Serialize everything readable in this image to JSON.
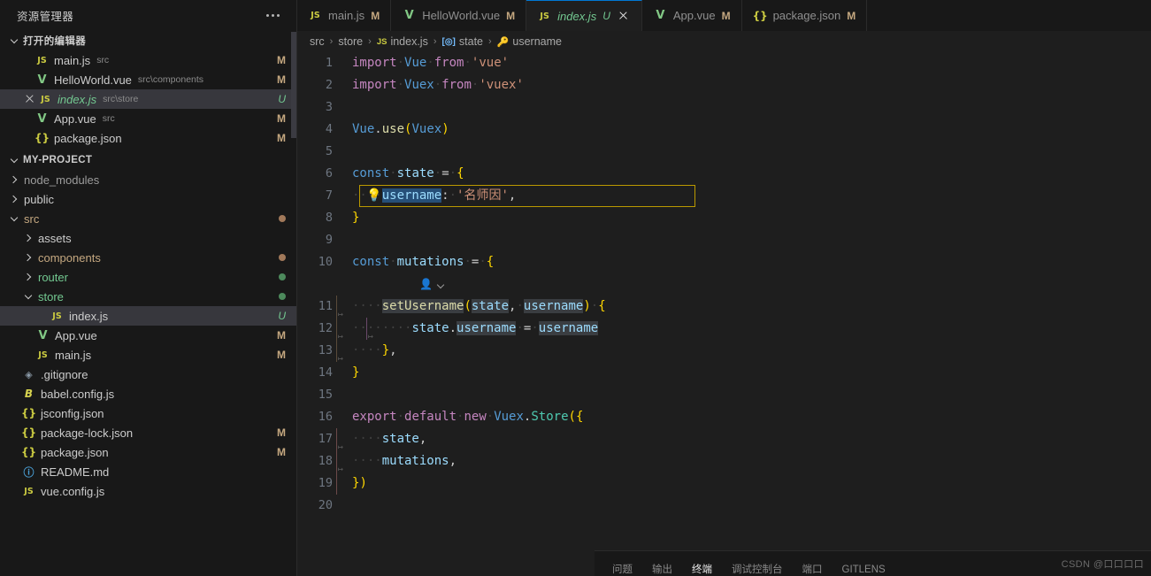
{
  "sidebar": {
    "title": "资源管理器",
    "more_label": "···",
    "open_editors": {
      "label": "打开的编辑器",
      "items": [
        {
          "icon": "js-file-icon",
          "glyph": "JS",
          "name": "main.js",
          "path": "src",
          "badge": "M",
          "selected": false,
          "unsaved": false
        },
        {
          "icon": "vue-file-icon",
          "glyph": "V",
          "name": "HelloWorld.vue",
          "path": "src\\components",
          "badge": "M",
          "selected": false,
          "unsaved": false
        },
        {
          "icon": "js-file-icon",
          "glyph": "JS",
          "name": "index.js",
          "path": "src\\store",
          "badge": "U",
          "selected": true,
          "unsaved": true
        },
        {
          "icon": "vue-file-icon",
          "glyph": "V",
          "name": "App.vue",
          "path": "src",
          "badge": "M",
          "selected": false,
          "unsaved": false
        },
        {
          "icon": "json-file-icon",
          "glyph": "{}",
          "name": "package.json",
          "path": "",
          "badge": "M",
          "selected": false,
          "unsaved": false
        }
      ]
    },
    "project": {
      "label": "MY-PROJECT",
      "tree": [
        {
          "kind": "folder",
          "name": "node_modules",
          "indent": 1,
          "expanded": false,
          "color": "c1",
          "dot": ""
        },
        {
          "kind": "folder",
          "name": "public",
          "indent": 1,
          "expanded": false,
          "color": "c2",
          "dot": ""
        },
        {
          "kind": "folder",
          "name": "src",
          "indent": 1,
          "expanded": true,
          "color": "c3",
          "dot": "#a1795a"
        },
        {
          "kind": "folder",
          "name": "assets",
          "indent": 2,
          "expanded": false,
          "color": "c4",
          "dot": ""
        },
        {
          "kind": "folder",
          "name": "components",
          "indent": 2,
          "expanded": false,
          "color": "c5",
          "dot": "#a1795a"
        },
        {
          "kind": "folder",
          "name": "router",
          "indent": 2,
          "expanded": false,
          "color": "c6",
          "dot": "#4d8a5c"
        },
        {
          "kind": "folder",
          "name": "store",
          "indent": 2,
          "expanded": true,
          "color": "c6",
          "dot": "#4d8a5c"
        },
        {
          "kind": "file",
          "name": "index.js",
          "indent": 3,
          "icon": "js-file-icon",
          "glyph": "JS",
          "iclass": "ic-js",
          "badge": "U",
          "badgeClass": "u",
          "selected": true
        },
        {
          "kind": "file",
          "name": "App.vue",
          "indent": 2,
          "icon": "vue-file-icon",
          "glyph": "V",
          "iclass": "ic-vue",
          "badge": "M",
          "badgeClass": "",
          "selected": false
        },
        {
          "kind": "file",
          "name": "main.js",
          "indent": 2,
          "icon": "js-file-icon",
          "glyph": "JS",
          "iclass": "ic-js",
          "badge": "M",
          "badgeClass": "",
          "selected": false
        },
        {
          "kind": "file",
          "name": ".gitignore",
          "indent": 1,
          "icon": "git-file-icon",
          "glyph": "◈",
          "iclass": "ic-git",
          "badge": "",
          "badgeClass": "",
          "selected": false
        },
        {
          "kind": "file",
          "name": "babel.config.js",
          "indent": 1,
          "icon": "babel-file-icon",
          "glyph": "B",
          "iclass": "ic-babel",
          "badge": "",
          "badgeClass": "",
          "selected": false
        },
        {
          "kind": "file",
          "name": "jsconfig.json",
          "indent": 1,
          "icon": "json-file-icon",
          "glyph": "{}",
          "iclass": "ic-json",
          "badge": "",
          "badgeClass": "",
          "selected": false
        },
        {
          "kind": "file",
          "name": "package-lock.json",
          "indent": 1,
          "icon": "json-file-icon",
          "glyph": "{}",
          "iclass": "ic-json",
          "badge": "M",
          "badgeClass": "",
          "selected": false
        },
        {
          "kind": "file",
          "name": "package.json",
          "indent": 1,
          "icon": "json-file-icon",
          "glyph": "{}",
          "iclass": "ic-json",
          "badge": "M",
          "badgeClass": "",
          "selected": false
        },
        {
          "kind": "file",
          "name": "README.md",
          "indent": 1,
          "icon": "info-file-icon",
          "glyph": "ⓘ",
          "iclass": "ic-md",
          "badge": "",
          "badgeClass": "",
          "selected": false
        },
        {
          "kind": "file",
          "name": "vue.config.js",
          "indent": 1,
          "icon": "js-file-icon",
          "glyph": "JS",
          "iclass": "ic-js",
          "badge": "",
          "badgeClass": "",
          "selected": false
        }
      ]
    }
  },
  "tabs": [
    {
      "glyph": "JS",
      "iclass": "ic-js",
      "name": "main.js",
      "badge": "M",
      "active": false,
      "closable": false
    },
    {
      "glyph": "V",
      "iclass": "ic-vue",
      "name": "HelloWorld.vue",
      "badge": "M",
      "active": false,
      "closable": false
    },
    {
      "glyph": "JS",
      "iclass": "ic-js",
      "name": "index.js",
      "badge": "U",
      "active": true,
      "closable": true
    },
    {
      "glyph": "V",
      "iclass": "ic-vue",
      "name": "App.vue",
      "badge": "M",
      "active": false,
      "closable": false
    },
    {
      "glyph": "{}",
      "iclass": "ic-json",
      "name": "package.json",
      "badge": "M",
      "active": false,
      "closable": false
    }
  ],
  "breadcrumb": [
    {
      "label": "src",
      "icon": "",
      "iclass": ""
    },
    {
      "label": "store",
      "icon": "",
      "iclass": ""
    },
    {
      "label": "index.js",
      "icon": "JS",
      "iclass": "js"
    },
    {
      "label": "state",
      "icon": "[◎]",
      "iclass": "sym"
    },
    {
      "label": "username",
      "icon": "🔑",
      "iclass": "prop"
    }
  ],
  "editor": {
    "language": "javascript",
    "filename": "index.js",
    "codelens_label": "",
    "lines": [
      {
        "n": "1",
        "raw": "import Vue from 'vue'"
      },
      {
        "n": "2",
        "raw": "import Vuex from 'vuex'"
      },
      {
        "n": "3",
        "raw": ""
      },
      {
        "n": "4",
        "raw": "Vue.use(Vuex)"
      },
      {
        "n": "5",
        "raw": ""
      },
      {
        "n": "6",
        "raw": "const state = {"
      },
      {
        "n": "7",
        "raw": "    username: '名师因',"
      },
      {
        "n": "8",
        "raw": "}"
      },
      {
        "n": "9",
        "raw": ""
      },
      {
        "n": "10",
        "raw": "const mutations = {"
      },
      {
        "n": "11",
        "raw": "    setUsername(state, username) {"
      },
      {
        "n": "12",
        "raw": "        state.username = username"
      },
      {
        "n": "13",
        "raw": "    },"
      },
      {
        "n": "14",
        "raw": "}"
      },
      {
        "n": "15",
        "raw": ""
      },
      {
        "n": "16",
        "raw": "export default new Vuex.Store({"
      },
      {
        "n": "17",
        "raw": "    state,"
      },
      {
        "n": "18",
        "raw": "    mutations,"
      },
      {
        "n": "19",
        "raw": "})"
      },
      {
        "n": "20",
        "raw": ""
      }
    ]
  },
  "panel": {
    "tabs": [
      {
        "label": "问题",
        "active": false
      },
      {
        "label": "输出",
        "active": false
      },
      {
        "label": "终端",
        "active": true
      },
      {
        "label": "调试控制台",
        "active": false
      },
      {
        "label": "端口",
        "active": false
      },
      {
        "label": "GITLENS",
        "active": false
      }
    ]
  },
  "watermark": "CSDN @口口口口"
}
